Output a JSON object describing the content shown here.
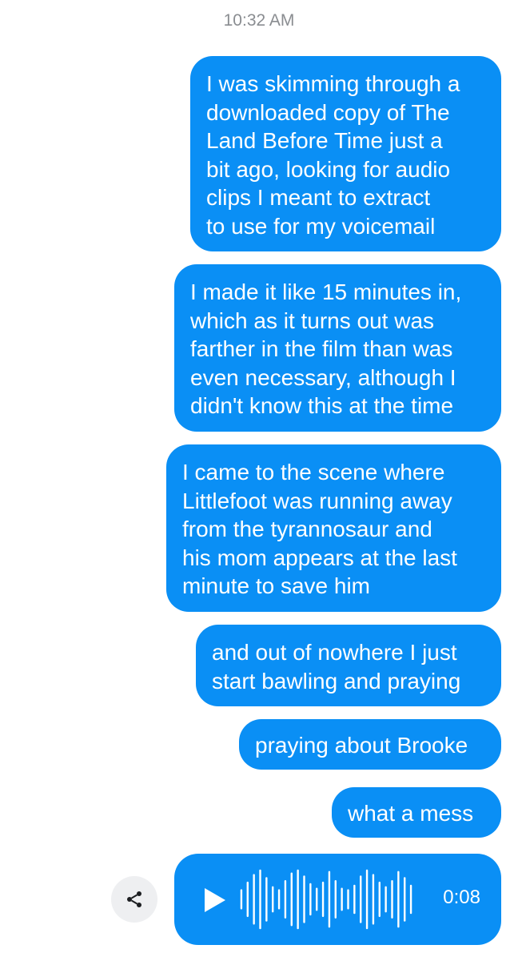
{
  "timestamp": "10:32 AM",
  "messages": [
    {
      "text": "I was skimming through a\ndownloaded copy of The\nLand Before Time just a\nbit ago, looking for audio\nclips I meant to extract\nto use for my voicemail"
    },
    {
      "text": "I made it like 15 minutes in,\nwhich as it turns out was\nfarther in the film than was\neven necessary, although I\ndidn't know this at the time"
    },
    {
      "text": "I came to the scene where\nLittlefoot was running away\nfrom the tyrannosaur and\nhis mom appears at the last\nminute to save him"
    },
    {
      "text": "and out of nowhere I just\nstart bawling and praying"
    },
    {
      "text": "praying about Brooke"
    },
    {
      "text": "what a mess"
    }
  ],
  "voice_message": {
    "duration": "0:08",
    "waveform_levels": [
      0.3,
      0.55,
      0.8,
      0.95,
      0.7,
      0.4,
      0.3,
      0.6,
      0.85,
      0.95,
      0.75,
      0.5,
      0.35,
      0.55,
      0.9,
      0.6,
      0.35,
      0.3,
      0.45,
      0.75,
      0.95,
      0.8,
      0.55,
      0.4,
      0.6,
      0.9,
      0.7,
      0.45
    ]
  },
  "icons": {
    "play": "play-icon",
    "share": "share-icon"
  },
  "colors": {
    "bubble": "#0a8ff5",
    "text_on_bubble": "#ffffff",
    "timestamp": "#8a8d91",
    "share_button_bg": "#eeeff1"
  }
}
